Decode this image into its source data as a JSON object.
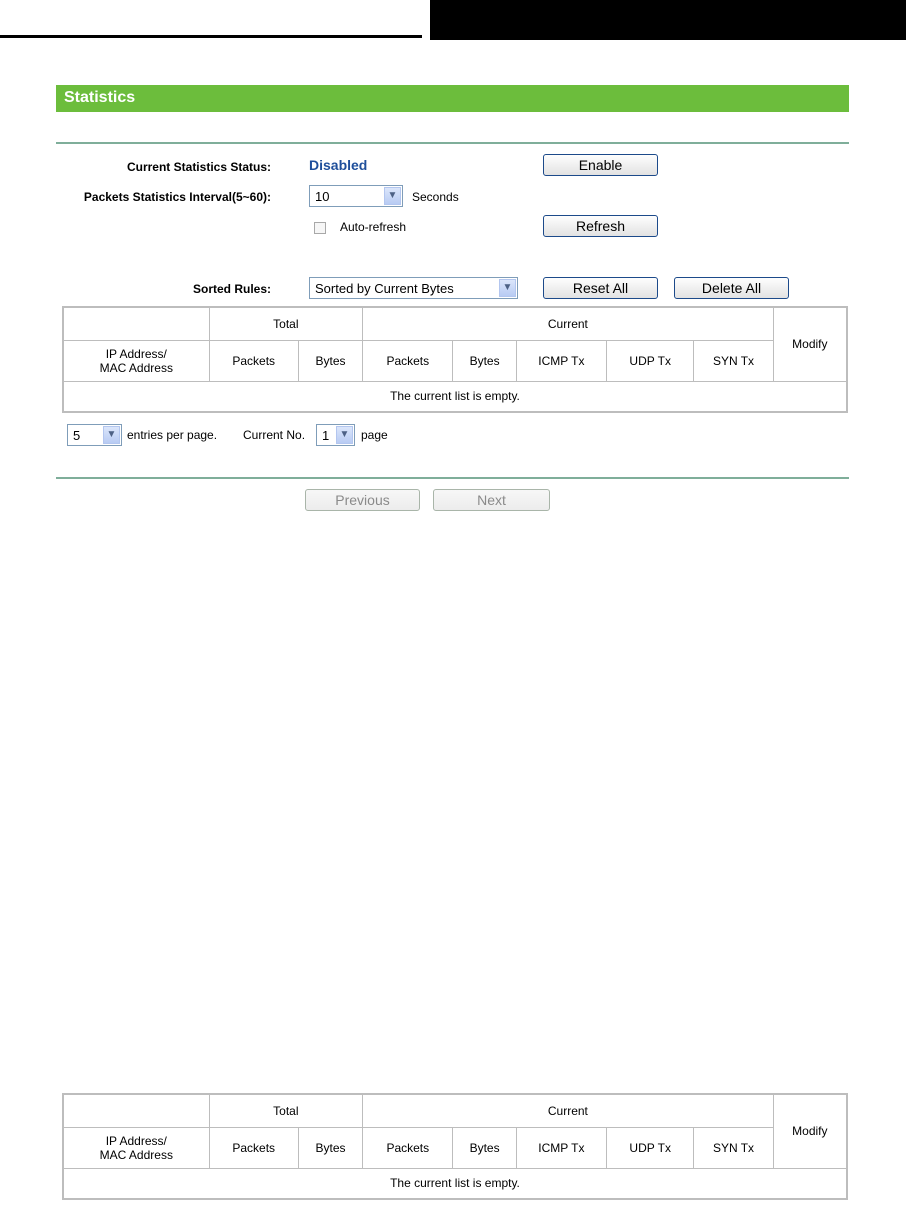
{
  "page": {
    "title": "Statistics"
  },
  "form": {
    "status_label": "Current Statistics Status:",
    "status_value": "Disabled",
    "enable_label": "Enable",
    "interval_label": "Packets Statistics Interval(5~60):",
    "interval_value": "10",
    "seconds_label": "Seconds",
    "autorefresh_label": "Auto-refresh",
    "autorefresh_checked": false,
    "refresh_label": "Refresh",
    "sorted_label": "Sorted Rules:",
    "sorted_value": "Sorted by Current Bytes",
    "reset_label": "Reset All",
    "delete_label": "Delete All"
  },
  "table": {
    "group_total": "Total",
    "group_current": "Current",
    "col_ip": "IP Address/",
    "col_mac": "MAC Address",
    "col_total_packets": "Packets",
    "col_total_bytes": "Bytes",
    "col_cur_packets": "Packets",
    "col_cur_bytes": "Bytes",
    "col_icmp": "ICMP Tx",
    "col_udp": "UDP Tx",
    "col_syn": "SYN Tx",
    "col_modify": "Modify",
    "empty_text": "The current list is empty."
  },
  "paging": {
    "entries_value": "5",
    "entries_label": "entries per page.",
    "current_label": "Current No.",
    "page_value": "1",
    "page_label": "page",
    "previous_label": "Previous",
    "next_label": "Next"
  },
  "colors": {
    "title_bar": "#6cbd3c",
    "status": "#1f4f9b",
    "rule": "#7fae9a"
  }
}
